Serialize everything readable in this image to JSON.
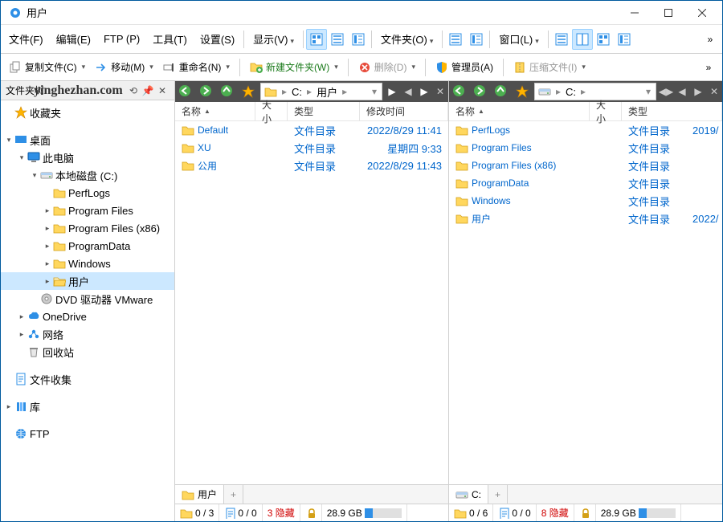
{
  "title": "用户",
  "watermark": "yinghezhan.com",
  "menu": {
    "file": "文件(F)",
    "edit": "编辑(E)",
    "ftp": "FTP (P)",
    "tools": "工具(T)",
    "settings": "设置(S)",
    "view": "显示(V)",
    "folder": "文件夹(O)",
    "window": "窗口(L)"
  },
  "toolbar2": {
    "copy": "复制文件(C)",
    "move": "移动(M)",
    "rename": "重命名(N)",
    "newfolder": "新建文件夹(W)",
    "delete": "删除(D)",
    "admin": "管理员(A)",
    "compress": "压缩文件(I)"
  },
  "tree": {
    "header": "文件夹树",
    "fav": "收藏夹",
    "desktop": "桌面",
    "thispc": "此电脑",
    "localc": "本地磁盘 (C:)",
    "perflogs": "PerfLogs",
    "progfiles": "Program Files",
    "progfiles86": "Program Files (x86)",
    "progdata": "ProgramData",
    "windows": "Windows",
    "users": "用户",
    "dvd": "DVD 驱动器 VMware",
    "onedrive": "OneDrive",
    "network": "网络",
    "recycle": "回收站",
    "filecollect": "文件收集",
    "library": "库",
    "ftp": "FTP"
  },
  "left": {
    "path": {
      "drive": "C:",
      "seg1": "用户"
    },
    "cols": {
      "name": "名称",
      "size": "大小",
      "type": "类型",
      "modified": "修改时间"
    },
    "rows": [
      {
        "name": "Default",
        "type": "文件目录",
        "modified": "2022/8/29  11:41"
      },
      {
        "name": "XU",
        "type": "文件目录",
        "modified": "星期四      9:33"
      },
      {
        "name": "公用",
        "type": "文件目录",
        "modified": "2022/8/29  11:43"
      }
    ],
    "tab": "用户",
    "status": {
      "count1": "0 / 3",
      "count2": "0 / 0",
      "hidden": "3 隐藏",
      "disk": "28.9 GB",
      "fill": 22
    }
  },
  "right": {
    "path": {
      "drive": "C:"
    },
    "cols": {
      "name": "名称",
      "size": "大小",
      "type": "类型"
    },
    "rows": [
      {
        "name": "PerfLogs",
        "type": "文件目录",
        "modified": "2019/"
      },
      {
        "name": "Program Files",
        "type": "文件目录",
        "modified": ""
      },
      {
        "name": "Program Files (x86)",
        "type": "文件目录",
        "modified": ""
      },
      {
        "name": "ProgramData",
        "type": "文件目录",
        "modified": ""
      },
      {
        "name": "Windows",
        "type": "文件目录",
        "modified": ""
      },
      {
        "name": "用户",
        "type": "文件目录",
        "modified": "2022/"
      }
    ],
    "tab": "C:",
    "status": {
      "count1": "0 / 6",
      "count2": "0 / 0",
      "hidden": "8 隐藏",
      "disk": "28.9 GB",
      "fill": 22
    }
  }
}
